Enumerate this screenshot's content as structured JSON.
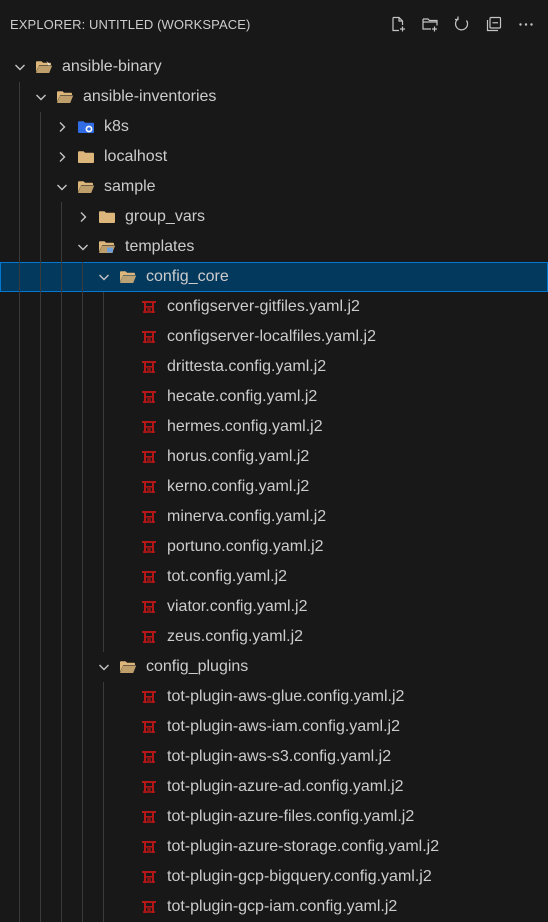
{
  "header": {
    "title": "EXPLORER: UNTITLED (WORKSPACE)",
    "actions": [
      "new-file-icon",
      "new-folder-icon",
      "refresh-icon",
      "collapse-all-icon",
      "more-icon"
    ]
  },
  "colors": {
    "background": "#181818",
    "selection": "#04395e",
    "selection_border": "#0078d4",
    "folder": "#dcb67a",
    "jinja": "#b41717",
    "k8s": "#326ce5"
  },
  "tree": [
    {
      "label": "ansible-binary",
      "depth": 0,
      "kind": "folder-open",
      "chevron": "down",
      "icon": "ansible-folder-icon"
    },
    {
      "label": "ansible-inventories",
      "depth": 1,
      "kind": "folder-open",
      "chevron": "down",
      "icon": "folder-open-icon"
    },
    {
      "label": "k8s",
      "depth": 2,
      "kind": "folder",
      "chevron": "right",
      "icon": "kubernetes-folder-icon"
    },
    {
      "label": "localhost",
      "depth": 2,
      "kind": "folder",
      "chevron": "right",
      "icon": "folder-icon"
    },
    {
      "label": "sample",
      "depth": 2,
      "kind": "folder-open",
      "chevron": "down",
      "icon": "folder-open-icon"
    },
    {
      "label": "group_vars",
      "depth": 3,
      "kind": "folder",
      "chevron": "right",
      "icon": "folder-icon"
    },
    {
      "label": "templates",
      "depth": 3,
      "kind": "folder-open",
      "chevron": "down",
      "icon": "templates-folder-icon"
    },
    {
      "label": "config_core",
      "depth": 4,
      "kind": "folder-open",
      "chevron": "down",
      "icon": "folder-open-icon",
      "selected": true
    },
    {
      "label": "configserver-gitfiles.yaml.j2",
      "depth": 5,
      "kind": "file",
      "icon": "jinja-icon"
    },
    {
      "label": "configserver-localfiles.yaml.j2",
      "depth": 5,
      "kind": "file",
      "icon": "jinja-icon"
    },
    {
      "label": "drittesta.config.yaml.j2",
      "depth": 5,
      "kind": "file",
      "icon": "jinja-icon"
    },
    {
      "label": "hecate.config.yaml.j2",
      "depth": 5,
      "kind": "file",
      "icon": "jinja-icon"
    },
    {
      "label": "hermes.config.yaml.j2",
      "depth": 5,
      "kind": "file",
      "icon": "jinja-icon"
    },
    {
      "label": "horus.config.yaml.j2",
      "depth": 5,
      "kind": "file",
      "icon": "jinja-icon"
    },
    {
      "label": "kerno.config.yaml.j2",
      "depth": 5,
      "kind": "file",
      "icon": "jinja-icon"
    },
    {
      "label": "minerva.config.yaml.j2",
      "depth": 5,
      "kind": "file",
      "icon": "jinja-icon"
    },
    {
      "label": "portuno.config.yaml.j2",
      "depth": 5,
      "kind": "file",
      "icon": "jinja-icon"
    },
    {
      "label": "tot.config.yaml.j2",
      "depth": 5,
      "kind": "file",
      "icon": "jinja-icon"
    },
    {
      "label": "viator.config.yaml.j2",
      "depth": 5,
      "kind": "file",
      "icon": "jinja-icon"
    },
    {
      "label": "zeus.config.yaml.j2",
      "depth": 5,
      "kind": "file",
      "icon": "jinja-icon"
    },
    {
      "label": "config_plugins",
      "depth": 4,
      "kind": "folder-open",
      "chevron": "down",
      "icon": "folder-open-icon"
    },
    {
      "label": "tot-plugin-aws-glue.config.yaml.j2",
      "depth": 5,
      "kind": "file",
      "icon": "jinja-icon"
    },
    {
      "label": "tot-plugin-aws-iam.config.yaml.j2",
      "depth": 5,
      "kind": "file",
      "icon": "jinja-icon"
    },
    {
      "label": "tot-plugin-aws-s3.config.yaml.j2",
      "depth": 5,
      "kind": "file",
      "icon": "jinja-icon"
    },
    {
      "label": "tot-plugin-azure-ad.config.yaml.j2",
      "depth": 5,
      "kind": "file",
      "icon": "jinja-icon"
    },
    {
      "label": "tot-plugin-azure-files.config.yaml.j2",
      "depth": 5,
      "kind": "file",
      "icon": "jinja-icon"
    },
    {
      "label": "tot-plugin-azure-storage.config.yaml.j2",
      "depth": 5,
      "kind": "file",
      "icon": "jinja-icon"
    },
    {
      "label": "tot-plugin-gcp-bigquery.config.yaml.j2",
      "depth": 5,
      "kind": "file",
      "icon": "jinja-icon"
    },
    {
      "label": "tot-plugin-gcp-iam.config.yaml.j2",
      "depth": 5,
      "kind": "file",
      "icon": "jinja-icon"
    }
  ]
}
